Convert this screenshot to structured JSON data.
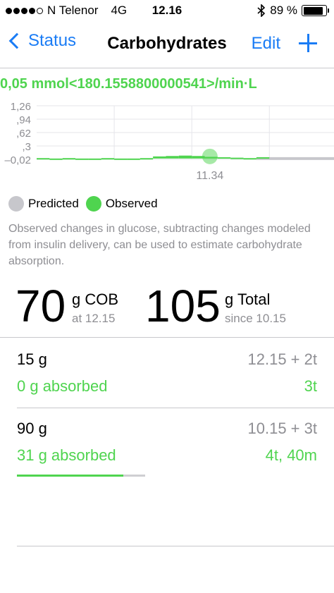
{
  "status_bar": {
    "signal_dots": [
      1,
      1,
      1,
      1,
      0
    ],
    "carrier": "N Telenor",
    "network": "4G",
    "time": "12.16",
    "bluetooth_icon": "bluetooth-icon",
    "battery_text": "89 %",
    "battery_level": 0.89
  },
  "nav": {
    "back_label": "Status",
    "title": "Carbohydrates",
    "edit_label": "Edit",
    "add_icon": "plus-icon"
  },
  "chart": {
    "rate_label": "0,05 mmol<180.1558800000541>/min·L"
  },
  "chart_data": {
    "type": "bar",
    "yticks": [
      "1,26",
      ",94",
      ",62",
      ",3",
      "–0,02"
    ],
    "ylim": [
      -0.02,
      1.26
    ],
    "xlabel_marker": "11.34",
    "marker_x": 11.34,
    "x_range": [
      10.0,
      12.3
    ],
    "grid": true,
    "colors": {
      "observed": "#4fd44f",
      "predicted": "#c7c7cc",
      "marker": "#4fd44f"
    },
    "series": [
      {
        "name": "Observed",
        "x": [
          10.0,
          10.1,
          10.2,
          10.3,
          10.4,
          10.5,
          10.6,
          10.7,
          10.8,
          10.9,
          11.0,
          11.1,
          11.2,
          11.3,
          11.4,
          11.5,
          11.6,
          11.7
        ],
        "values": [
          0.01,
          0.0,
          0.01,
          -0.01,
          0.0,
          0.01,
          0.0,
          0.0,
          0.01,
          0.05,
          0.06,
          0.07,
          0.06,
          0.04,
          0.03,
          0.02,
          0.01,
          0.03
        ]
      },
      {
        "name": "Predicted",
        "x": [
          11.7,
          12.3
        ],
        "values": [
          0.0,
          0.0
        ]
      }
    ]
  },
  "legend": {
    "predicted_label": "Predicted",
    "observed_label": "Observed"
  },
  "description": "Observed changes in glucose, subtracting changes modeled from insulin delivery, can be used to estimate carbohydrate absorption.",
  "summary": {
    "cob_value": "70",
    "cob_unit": "g COB",
    "cob_time": "at 12.15",
    "total_value": "105",
    "total_unit": "g Total",
    "total_time": "since 10.15"
  },
  "entries": [
    {
      "amount": "15 g",
      "time": "12.15 + 2t",
      "absorbed": "0 g absorbed",
      "remaining": "3t",
      "progress": 0.0
    },
    {
      "amount": "90 g",
      "time": "10.15 + 3t",
      "absorbed": "31 g absorbed",
      "remaining": "4t, 40m",
      "progress": 0.83
    }
  ]
}
